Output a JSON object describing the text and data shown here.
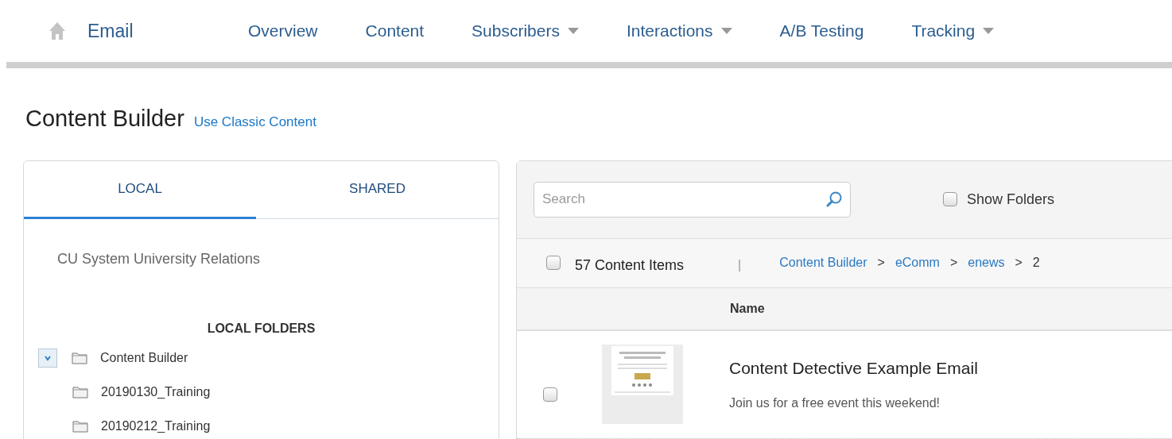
{
  "nav": {
    "title": "Email",
    "items": [
      {
        "label": "Overview",
        "dropdown": false
      },
      {
        "label": "Content",
        "dropdown": false
      },
      {
        "label": "Subscribers",
        "dropdown": true
      },
      {
        "label": "Interactions",
        "dropdown": true
      },
      {
        "label": "A/B Testing",
        "dropdown": false
      },
      {
        "label": "Tracking",
        "dropdown": true
      }
    ]
  },
  "page": {
    "title": "Content Builder",
    "link": "Use Classic Content"
  },
  "left_panel": {
    "tabs": [
      {
        "label": "LOCAL",
        "selected": true
      },
      {
        "label": "SHARED",
        "selected": false
      }
    ],
    "account": "CU System University Relations",
    "folders_heading": "LOCAL FOLDERS",
    "tree": [
      {
        "label": "Content Builder",
        "expanded": true,
        "children": [
          {
            "label": "20190130_Training"
          },
          {
            "label": "20190212_Training"
          }
        ]
      }
    ]
  },
  "right_panel": {
    "search": {
      "placeholder": "Search"
    },
    "show_folders": {
      "label": "Show Folders",
      "checked": false
    },
    "select_all_checked": false,
    "count": "57 Content Items",
    "separator": "|",
    "breadcrumb": [
      "Content Builder",
      "eComm",
      "enews",
      "2"
    ],
    "breadcrumb_separator": ">",
    "columns": [
      "Name"
    ],
    "rows": [
      {
        "checked": false,
        "title": "Content Detective Example Email",
        "subtitle": "Join us for a free event this weekend!"
      }
    ]
  }
}
